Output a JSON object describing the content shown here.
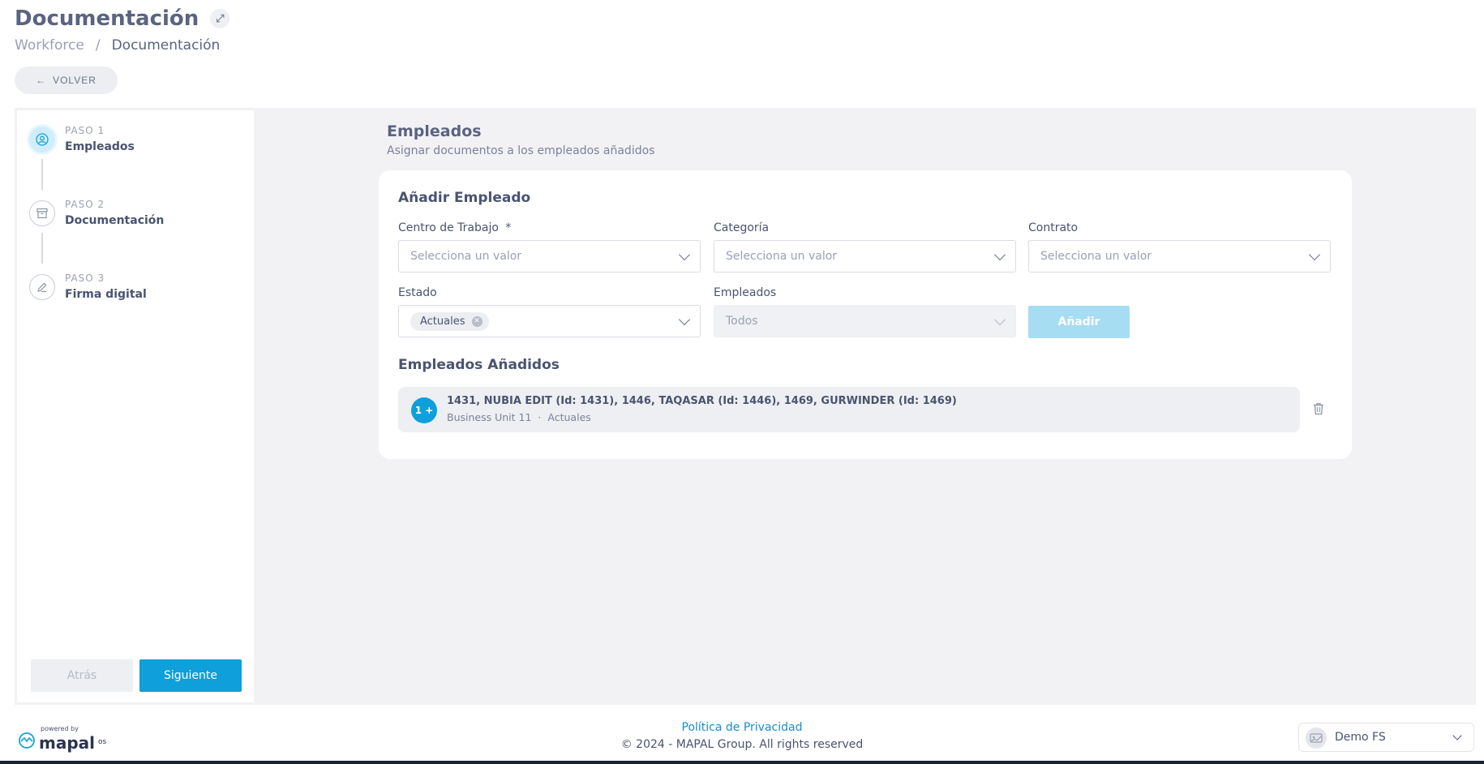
{
  "header": {
    "title": "Documentación",
    "breadcrumb": [
      "Workforce",
      "/",
      "Documentación"
    ],
    "back_label": "VOLVER"
  },
  "stepper": {
    "steps": [
      {
        "num": "PASO 1",
        "label": "Empleados",
        "icon": "user-circle-icon",
        "active": true
      },
      {
        "num": "PASO 2",
        "label": "Documentación",
        "icon": "archive-icon",
        "active": false
      },
      {
        "num": "PASO 3",
        "label": "Firma digital",
        "icon": "pen-icon",
        "active": false
      }
    ],
    "back_button": "Atrás",
    "next_button": "Siguiente"
  },
  "content": {
    "title": "Empleados",
    "subtitle": "Asignar documentos a los empleados añadidos",
    "card": {
      "title": "Añadir Empleado",
      "fields": {
        "centro": {
          "label": "Centro de Trabajo",
          "required_mark": "*",
          "placeholder": "Selecciona un valor"
        },
        "categoria": {
          "label": "Categoría",
          "placeholder": "Selecciona un valor"
        },
        "contrato": {
          "label": "Contrato",
          "placeholder": "Selecciona un valor"
        },
        "estado": {
          "label": "Estado",
          "chip": "Actuales"
        },
        "empleados": {
          "label": "Empleados",
          "value": "Todos"
        }
      },
      "add_button": "Añadir",
      "added_title": "Empleados Añadidos",
      "added_rows": [
        {
          "badge": "1 +",
          "names": "1431, NUBIA EDIT (Id: 1431), 1446, TAQASAR (Id: 1446), 1469, GURWINDER (Id: 1469)",
          "unit": "Business Unit 11",
          "separator": "·",
          "status": "Actuales"
        }
      ]
    }
  },
  "footer": {
    "powered_by": "powered by",
    "logo_word": "mapal",
    "logo_suffix": "os",
    "privacy": "Política de Privacidad",
    "copyright": "© 2024 - MAPAL Group. All rights reserved",
    "tenant": "Demo FS"
  },
  "colors": {
    "accent": "#0f9fda",
    "accent_disabled": "#a6ddf3",
    "background_gray": "#f2f2f5",
    "text": "#4a5370"
  }
}
